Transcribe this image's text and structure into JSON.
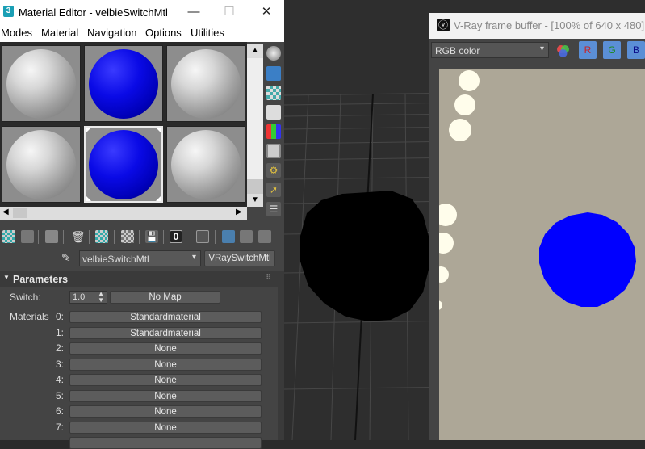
{
  "material_editor": {
    "title": "Material Editor - velbieSwitchMtl",
    "app_icon": "3",
    "window_buttons": {
      "minimize": "—",
      "maximize": "☐",
      "close": "✕"
    },
    "menu": [
      "Modes",
      "Material",
      "Navigation",
      "Options",
      "Utilities"
    ],
    "slots": [
      {
        "material": "gray",
        "selected": false
      },
      {
        "material": "blue",
        "selected": false
      },
      {
        "material": "gray",
        "selected": false
      },
      {
        "material": "gray",
        "selected": false
      },
      {
        "material": "blue",
        "selected": true
      },
      {
        "material": "gray",
        "selected": false
      }
    ],
    "material_name": "velbieSwitchMtl",
    "material_type": "VRaySwitchMtl",
    "toolbar_zero": "0",
    "parameters": {
      "header": "Parameters",
      "switch_label": "Switch:",
      "switch_value": "1.0",
      "switch_map": "No Map",
      "materials_label": "Materials",
      "slots": [
        {
          "index": "0:",
          "value": "Standardmaterial"
        },
        {
          "index": "1:",
          "value": "Standardmaterial"
        },
        {
          "index": "2:",
          "value": "None"
        },
        {
          "index": "3:",
          "value": "None"
        },
        {
          "index": "4:",
          "value": "None"
        },
        {
          "index": "5:",
          "value": "None"
        },
        {
          "index": "6:",
          "value": "None"
        },
        {
          "index": "7:",
          "value": "None"
        }
      ]
    }
  },
  "vfb": {
    "title": "V-Ray frame buffer - [100% of 640 x 480]",
    "channel": "RGB color",
    "channel_buttons": [
      "R",
      "G",
      "B"
    ],
    "background_color": "#ada797",
    "sphere_color": "#0000ff"
  },
  "viewport": {
    "background_color": "#2e2e2e",
    "sphere_color": "#000000"
  }
}
